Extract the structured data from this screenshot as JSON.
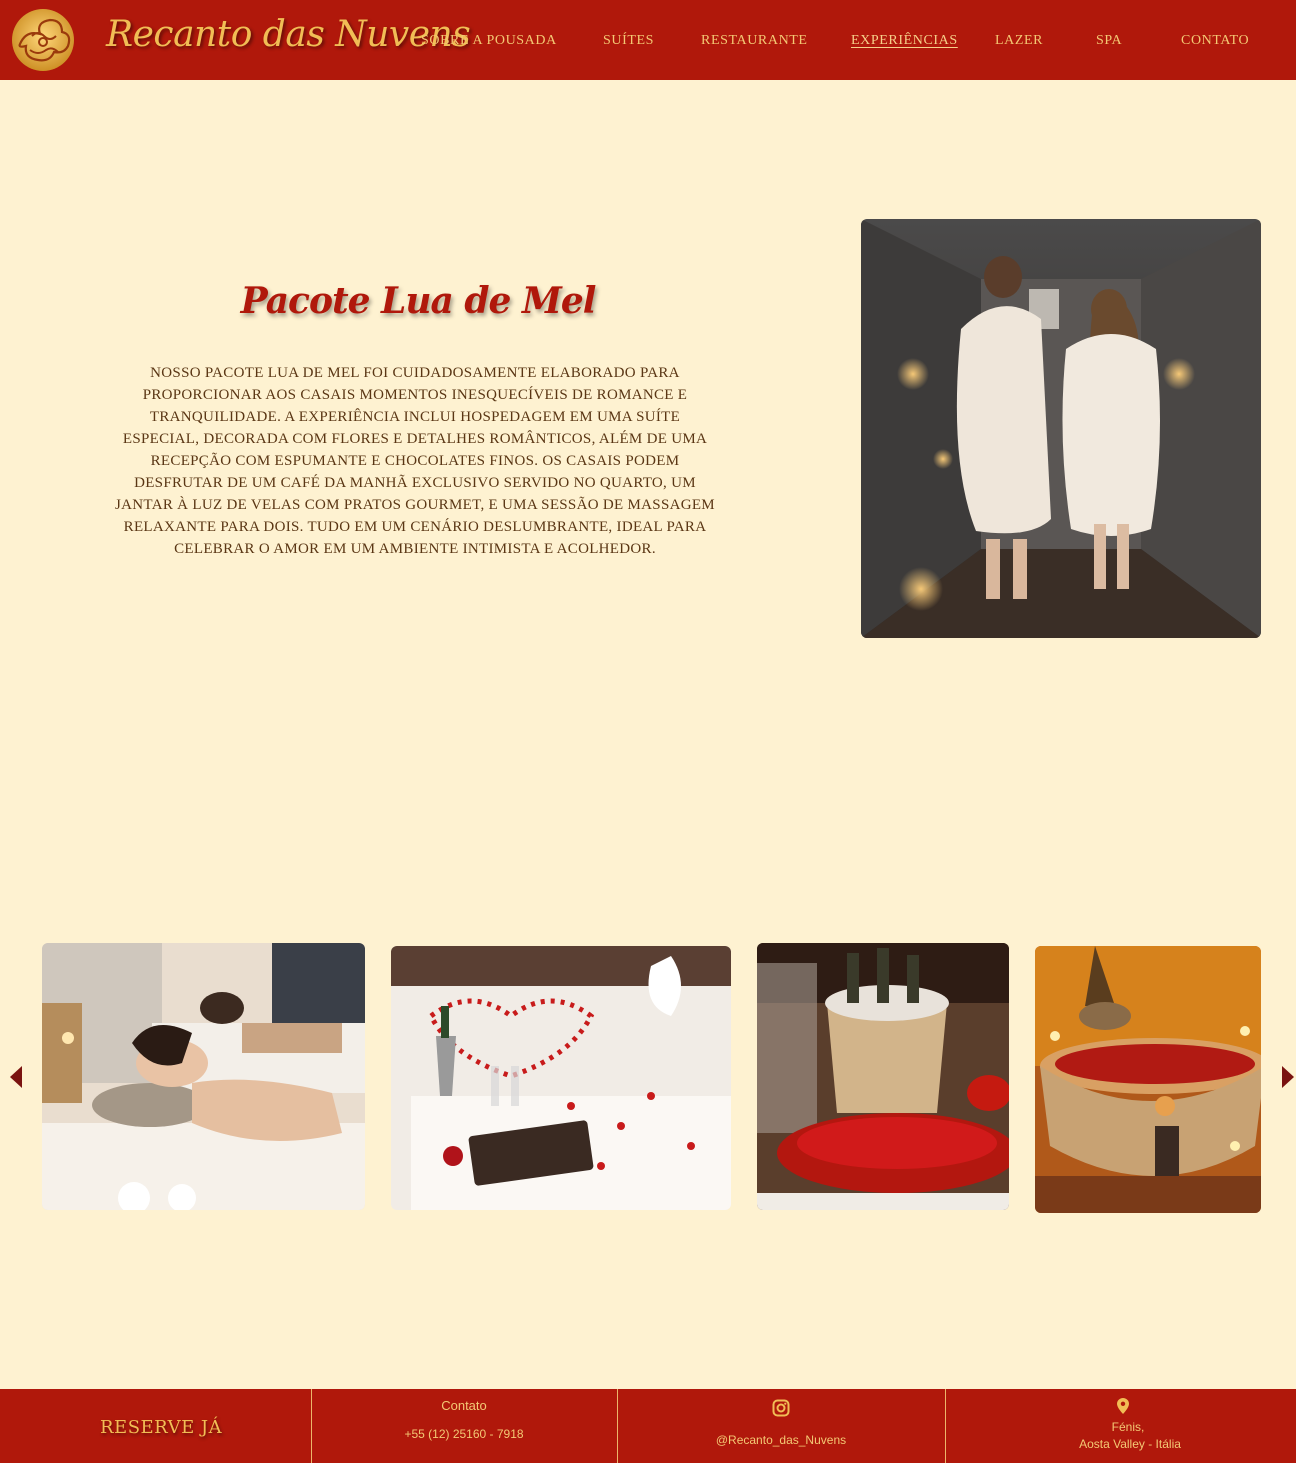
{
  "header": {
    "brand": "Recanto das Nuvens",
    "nav": [
      {
        "label": "SOBRE A POUSADA"
      },
      {
        "label": "SUÍTES"
      },
      {
        "label": "RESTAURANTE"
      },
      {
        "label": "EXPERIÊNCIAS",
        "active": true
      },
      {
        "label": "LAZER"
      },
      {
        "label": "SPA"
      },
      {
        "label": "CONTATO"
      }
    ]
  },
  "package": {
    "title": "Pacote Lua de Mel",
    "description": "Nosso Pacote Lua de Mel foi cuidadosamente elaborado para proporcionar aos casais momentos inesquecíveis de romance e tranquilidade. A experiência inclui hospedagem em uma suíte especial, decorada com flores e detalhes românticos, além de uma recepção com espumante e chocolates finos. Os casais podem desfrutar de um café da manhã exclusivo servido no quarto, um jantar à luz de velas com pratos gourmet, e uma sessão de massagem relaxante para dois. Tudo em um cenário deslumbrante,  ideal para celebrar o amor em um ambiente intimista e acolhedor."
  },
  "footer": {
    "reserve": "RESERVE JÁ",
    "contact_title": "Contato",
    "phone": "+55 (12) 25160 - 7918",
    "instagram": "@Recanto_das_Nuvens",
    "location_line1": "Fénis,",
    "location_line2": "Aosta Valley -  Itália"
  },
  "colors": {
    "header_bg": "#b0180b",
    "page_bg": "#fef2d1",
    "gold": "#f1bd55",
    "title_red": "#b0180b"
  }
}
